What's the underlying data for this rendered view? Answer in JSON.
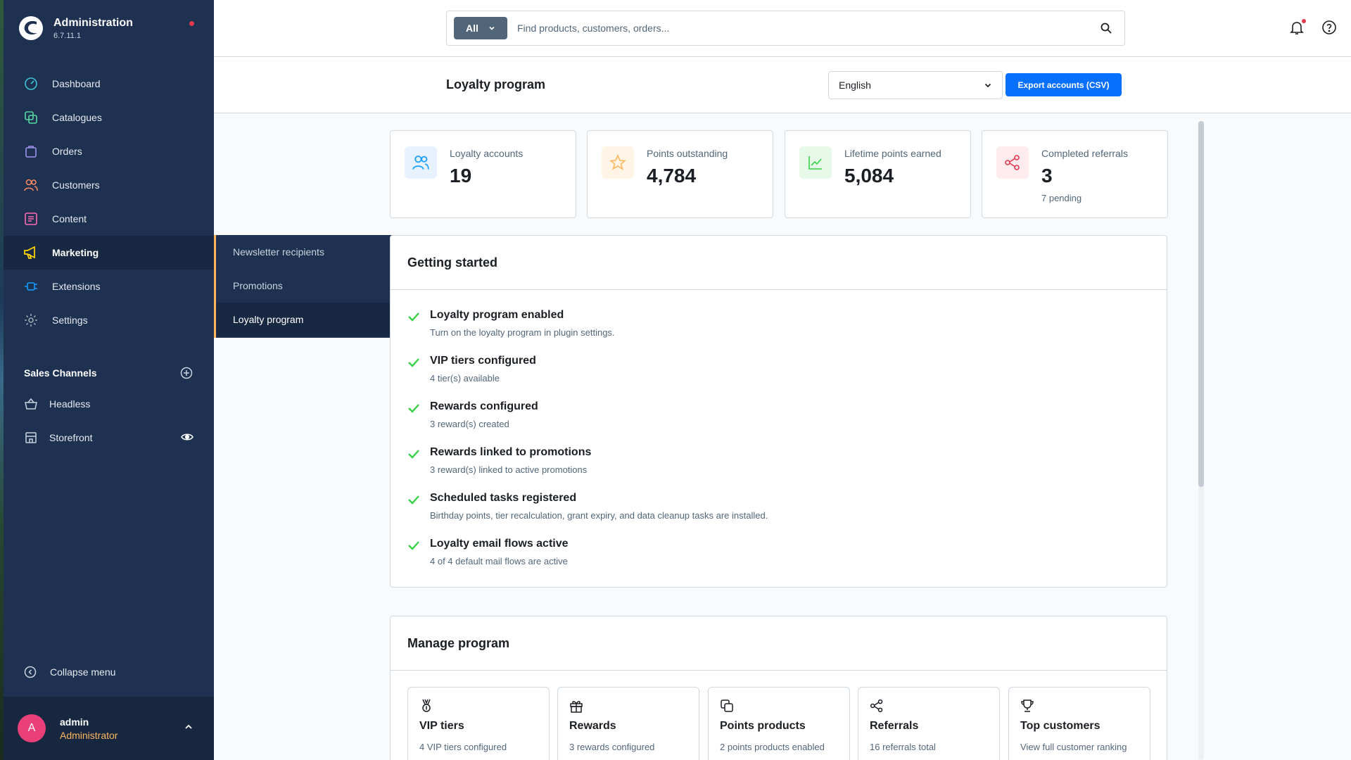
{
  "brand": {
    "title": "Administration",
    "version": "6.7.11.1"
  },
  "nav": {
    "items": [
      {
        "label": "Dashboard",
        "icon": "gauge-icon",
        "color": "#3ec6d6"
      },
      {
        "label": "Catalogues",
        "icon": "products-icon",
        "color": "#57d9a3"
      },
      {
        "label": "Orders",
        "icon": "shopping-bag-icon",
        "color": "#a092f0"
      },
      {
        "label": "Customers",
        "icon": "users-icon",
        "color": "#f88962"
      },
      {
        "label": "Content",
        "icon": "content-icon",
        "color": "#ff68b4"
      },
      {
        "label": "Marketing",
        "icon": "megaphone-icon",
        "color": "#ffd700"
      },
      {
        "label": "Extensions",
        "icon": "plug-icon",
        "color": "#189eff"
      },
      {
        "label": "Settings",
        "icon": "gear-icon",
        "color": "#9aa8b5"
      }
    ],
    "active": "Marketing"
  },
  "sales_channels": {
    "title": "Sales Channels",
    "items": [
      {
        "label": "Headless",
        "icon": "basket-icon"
      },
      {
        "label": "Storefront",
        "icon": "storefront-icon"
      }
    ]
  },
  "collapse_label": "Collapse menu",
  "user": {
    "initial": "A",
    "name": "admin",
    "role": "Administrator"
  },
  "flyout": {
    "items": [
      "Newsletter recipients",
      "Promotions",
      "Loyalty program"
    ],
    "active": "Loyalty program"
  },
  "search": {
    "type": "All",
    "placeholder": "Find products, customers, orders..."
  },
  "page": {
    "title": "Loyalty program",
    "language": "English",
    "export_label": "Export accounts (CSV)"
  },
  "stats": [
    {
      "label": "Loyalty accounts",
      "value": "19",
      "sub": "",
      "icon": "users-icon",
      "color": "#189eff",
      "bg": "#e8f2ff"
    },
    {
      "label": "Points outstanding",
      "value": "4,784",
      "sub": "",
      "icon": "star-icon",
      "color": "#ffb75d",
      "bg": "#fff4e5"
    },
    {
      "label": "Lifetime points earned",
      "value": "5,084",
      "sub": "",
      "icon": "chart-line-icon",
      "color": "#37d046",
      "bg": "#e6f8e8"
    },
    {
      "label": "Completed referrals",
      "value": "3",
      "sub": "7 pending",
      "icon": "share-icon",
      "color": "#e3384d",
      "bg": "#fdebed"
    }
  ],
  "getting_started": {
    "title": "Getting started",
    "items": [
      {
        "title": "Loyalty program enabled",
        "sub": "Turn on the loyalty program in plugin settings."
      },
      {
        "title": "VIP tiers configured",
        "sub": "4 tier(s) available"
      },
      {
        "title": "Rewards configured",
        "sub": "3 reward(s) created"
      },
      {
        "title": "Rewards linked to promotions",
        "sub": "3 reward(s) linked to active promotions"
      },
      {
        "title": "Scheduled tasks registered",
        "sub": "Birthday points, tier recalculation, grant expiry, and data cleanup tasks are installed."
      },
      {
        "title": "Loyalty email flows active",
        "sub": "4 of 4 default mail flows are active"
      }
    ]
  },
  "manage": {
    "title": "Manage program",
    "tiles": [
      {
        "title": "VIP tiers",
        "sub": "4 VIP tiers configured",
        "icon": "medal-icon"
      },
      {
        "title": "Rewards",
        "sub": "3 rewards configured",
        "icon": "gift-icon"
      },
      {
        "title": "Points products",
        "sub": "2 points products enabled",
        "icon": "copy-icon"
      },
      {
        "title": "Referrals",
        "sub": "16 referrals total",
        "icon": "share-icon"
      },
      {
        "title": "Top customers",
        "sub": "View full customer ranking",
        "icon": "trophy-icon"
      }
    ]
  },
  "colors": {
    "sidebar": "#1e3151",
    "accent": "#0870ff",
    "success": "#37d046",
    "role": "#ffb75d"
  }
}
